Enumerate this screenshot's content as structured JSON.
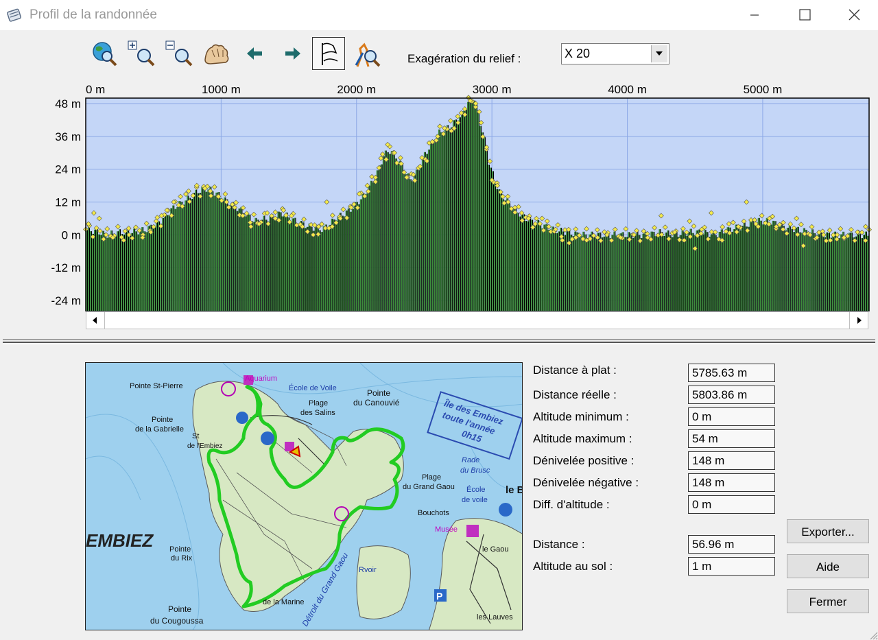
{
  "window": {
    "title": "Profil de la randonnée"
  },
  "toolbar": {
    "buttons": [
      "globe-zoom-icon",
      "zoom-in-icon",
      "zoom-out-icon",
      "pan-hand-icon",
      "arrow-left-icon",
      "arrow-right-icon",
      "flag-profile-icon",
      "hiker-zoom-icon"
    ],
    "exaggeration_label": "Exagération du relief :",
    "exaggeration_value": "X 20"
  },
  "chart_data": {
    "type": "bar",
    "xlabel": "",
    "ylabel": "",
    "x_ticks": [
      "0 m",
      "1000 m",
      "2000 m",
      "3000 m",
      "4000 m",
      "5000 m"
    ],
    "x_tick_values": [
      0,
      1000,
      2000,
      3000,
      4000,
      5000
    ],
    "y_ticks": [
      "48 m",
      "36 m",
      "24 m",
      "12 m",
      "0 m",
      "-12 m",
      "-24 m"
    ],
    "y_tick_values": [
      48,
      36,
      24,
      12,
      0,
      -12,
      -24
    ],
    "xlim": [
      0,
      5785.63
    ],
    "ylim": [
      -28,
      50
    ],
    "grid": true,
    "colors": {
      "background": "#c4d6f7",
      "bars": "#3c8c3c",
      "points": "#f3e94a",
      "grid": "#8ca8e6"
    },
    "profile": [
      [
        0,
        2
      ],
      [
        100,
        1
      ],
      [
        150,
        0
      ],
      [
        250,
        1
      ],
      [
        350,
        1
      ],
      [
        450,
        2
      ],
      [
        550,
        5
      ],
      [
        650,
        10
      ],
      [
        750,
        13
      ],
      [
        830,
        16
      ],
      [
        900,
        17
      ],
      [
        970,
        15
      ],
      [
        1050,
        12
      ],
      [
        1150,
        9
      ],
      [
        1250,
        5
      ],
      [
        1350,
        6
      ],
      [
        1450,
        8
      ],
      [
        1550,
        5
      ],
      [
        1650,
        3
      ],
      [
        1750,
        2
      ],
      [
        1850,
        6
      ],
      [
        1950,
        9
      ],
      [
        2050,
        14
      ],
      [
        2150,
        22
      ],
      [
        2200,
        29
      ],
      [
        2250,
        31
      ],
      [
        2300,
        28
      ],
      [
        2350,
        24
      ],
      [
        2400,
        20
      ],
      [
        2450,
        23
      ],
      [
        2500,
        29
      ],
      [
        2550,
        33
      ],
      [
        2600,
        37
      ],
      [
        2700,
        40
      ],
      [
        2780,
        44
      ],
      [
        2820,
        48
      ],
      [
        2870,
        50
      ],
      [
        2900,
        44
      ],
      [
        2940,
        36
      ],
      [
        2980,
        26
      ],
      [
        3050,
        16
      ],
      [
        3150,
        10
      ],
      [
        3250,
        6
      ],
      [
        3350,
        4
      ],
      [
        3450,
        2
      ],
      [
        3550,
        1
      ],
      [
        3650,
        0
      ],
      [
        3750,
        0
      ],
      [
        3850,
        0
      ],
      [
        3950,
        0
      ],
      [
        4050,
        0
      ],
      [
        4150,
        0
      ],
      [
        4250,
        1
      ],
      [
        4350,
        0
      ],
      [
        4450,
        1
      ],
      [
        4550,
        1
      ],
      [
        4650,
        0
      ],
      [
        4750,
        2
      ],
      [
        4850,
        3
      ],
      [
        4950,
        5
      ],
      [
        5050,
        5
      ],
      [
        5150,
        3
      ],
      [
        5250,
        2
      ],
      [
        5350,
        1
      ],
      [
        5450,
        0
      ],
      [
        5550,
        0
      ],
      [
        5650,
        0
      ],
      [
        5785.63,
        0
      ]
    ],
    "points_extra": [
      [
        20,
        4
      ],
      [
        60,
        8
      ],
      [
        100,
        6
      ],
      [
        150,
        0
      ],
      [
        200,
        -1
      ],
      [
        280,
        -2
      ],
      [
        320,
        0
      ],
      [
        420,
        -1
      ],
      [
        480,
        1
      ],
      [
        520,
        5
      ],
      [
        560,
        7
      ],
      [
        600,
        9
      ],
      [
        650,
        12
      ],
      [
        700,
        14
      ],
      [
        760,
        16
      ],
      [
        820,
        18
      ],
      [
        880,
        17
      ],
      [
        920,
        16
      ],
      [
        980,
        14
      ],
      [
        1040,
        12
      ],
      [
        1100,
        10
      ],
      [
        1160,
        7
      ],
      [
        1220,
        3
      ],
      [
        1280,
        4
      ],
      [
        1340,
        8
      ],
      [
        1400,
        6
      ],
      [
        1460,
        9
      ],
      [
        1520,
        7
      ],
      [
        1600,
        3
      ],
      [
        1680,
        0
      ],
      [
        1720,
        3
      ],
      [
        1780,
        12
      ],
      [
        1820,
        3
      ],
      [
        1880,
        6
      ],
      [
        1960,
        10
      ],
      [
        2020,
        15
      ],
      [
        2080,
        18
      ],
      [
        2140,
        21
      ],
      [
        2180,
        28
      ],
      [
        2230,
        33
      ],
      [
        2280,
        30
      ],
      [
        2330,
        26
      ],
      [
        2370,
        21
      ],
      [
        2420,
        22
      ],
      [
        2470,
        25
      ],
      [
        2520,
        27
      ],
      [
        2560,
        34
      ],
      [
        2600,
        36
      ],
      [
        2650,
        39
      ],
      [
        2700,
        38
      ],
      [
        2750,
        41
      ],
      [
        2800,
        46
      ],
      [
        2840,
        49
      ],
      [
        2880,
        48
      ],
      [
        2920,
        41
      ],
      [
        2960,
        32
      ],
      [
        3000,
        20
      ],
      [
        3040,
        18
      ],
      [
        3080,
        14
      ],
      [
        3120,
        12
      ],
      [
        3170,
        10
      ],
      [
        3220,
        8
      ],
      [
        3270,
        6
      ],
      [
        3320,
        4
      ],
      [
        3370,
        6
      ],
      [
        3420,
        3
      ],
      [
        3470,
        2
      ],
      [
        3520,
        -2
      ],
      [
        3570,
        -3
      ],
      [
        3620,
        -1
      ],
      [
        3700,
        -2
      ],
      [
        3780,
        -1
      ],
      [
        3850,
        0
      ],
      [
        3950,
        -1
      ],
      [
        4050,
        0
      ],
      [
        4150,
        -1
      ],
      [
        4250,
        7
      ],
      [
        4350,
        1
      ],
      [
        4420,
        -2
      ],
      [
        4460,
        5
      ],
      [
        4500,
        -5
      ],
      [
        4550,
        2
      ],
      [
        4620,
        8
      ],
      [
        4700,
        -2
      ],
      [
        4750,
        4
      ],
      [
        4820,
        3
      ],
      [
        4880,
        12
      ],
      [
        4950,
        4
      ],
      [
        5050,
        6
      ],
      [
        5100,
        3
      ],
      [
        5150,
        2
      ],
      [
        5250,
        6
      ],
      [
        5300,
        -4
      ],
      [
        5350,
        0
      ],
      [
        5400,
        -1
      ],
      [
        5450,
        0
      ],
      [
        5500,
        -2
      ],
      [
        5550,
        0
      ],
      [
        5600,
        -1
      ],
      [
        5700,
        1
      ],
      [
        5760,
        3
      ]
    ]
  },
  "scrollbar": {
    "left_icon": "scroll-left-arrow-icon",
    "right_icon": "scroll-right-arrow-icon"
  },
  "map": {
    "labels": [
      "Pointe St-Pierre",
      "Aquarium",
      "École de Voile",
      "Pointe",
      "du Canouvié",
      "Plage",
      "des Salins",
      "Pointe",
      "de la Gabrielle",
      "St",
      "de l'Embiez",
      "Île des Embiez",
      "toute l'année",
      "0h15",
      "Rade",
      "du Brusc",
      "Plage",
      "du Grand Gaou",
      "École",
      "de voile",
      "le B",
      "Bouchots",
      "Musée",
      "le Gaou",
      "EMBIEZ",
      "Pointe",
      "du Rix",
      "Pointe",
      "du Cougoussa",
      "Rvoir",
      "Détroit du Grand Gaou",
      "de la Marine",
      "les Lauves",
      "P"
    ]
  },
  "stats": [
    {
      "label": "Distance à plat :",
      "value": "5785.63 m"
    },
    {
      "label": "Distance réelle :",
      "value": "5803.86 m"
    },
    {
      "label": "Altitude minimum :",
      "value": "0 m"
    },
    {
      "label": "Altitude maximum :",
      "value": "54 m"
    },
    {
      "label": "Dénivelée positive :",
      "value": "148 m"
    },
    {
      "label": "Dénivelée négative :",
      "value": "148 m"
    },
    {
      "label": "Diff. d'altitude :",
      "value": "0 m"
    }
  ],
  "cursor_stats": [
    {
      "label": "Distance :",
      "value": "56.96 m"
    },
    {
      "label": "Altitude au sol :",
      "value": "1 m"
    }
  ],
  "buttons": {
    "export": "Exporter...",
    "help": "Aide",
    "close": "Fermer"
  }
}
